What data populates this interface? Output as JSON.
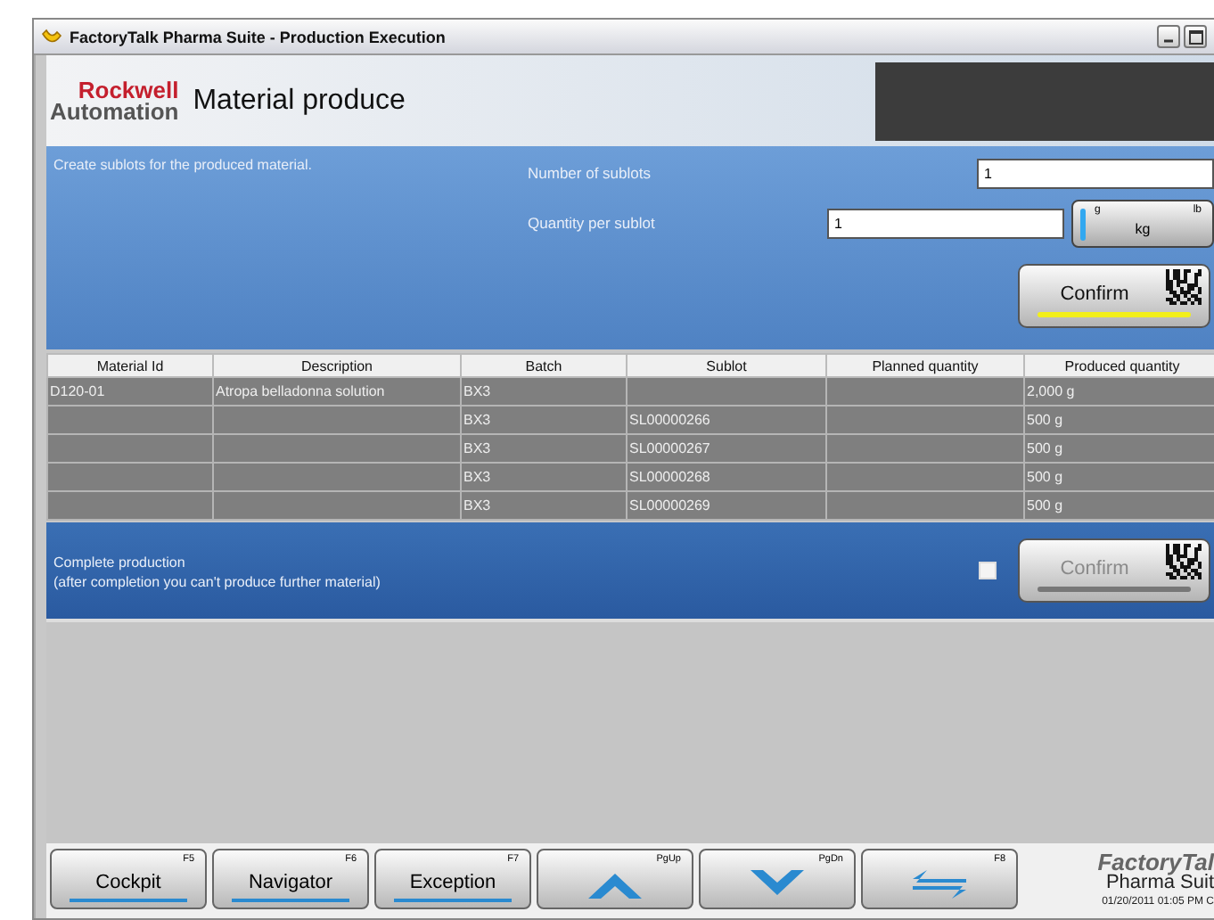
{
  "window": {
    "title": "FactoryTalk Pharma Suite - Production Execution"
  },
  "header": {
    "logo_top": "Rockwell",
    "logo_bottom": "Automation",
    "title": "Material produce"
  },
  "sublot_panel": {
    "instruction": "Create sublots for the produced material.",
    "fields": [
      {
        "label": "Number of sublots",
        "value": "1"
      },
      {
        "label": "Quantity per sublot",
        "value": "1"
      }
    ],
    "unit_switch": {
      "left": "g",
      "center": "kg",
      "right": "lb",
      "level": 0
    },
    "confirm": {
      "label": "Confirm",
      "disabled": false
    }
  },
  "table": {
    "columns": [
      "Material Id",
      "Description",
      "Batch",
      "Sublot",
      "Planned quantity",
      "Produced quantity"
    ],
    "rows": [
      [
        "D120-01",
        "Atropa belladonna solution",
        "BX3",
        "",
        "",
        "2,000 g"
      ],
      [
        "",
        "",
        "BX3",
        "SL00000266",
        "",
        "500 g"
      ],
      [
        "",
        "",
        "BX3",
        "SL00000267",
        "",
        "500 g"
      ],
      [
        "",
        "",
        "BX3",
        "SL00000268",
        "",
        "500 g"
      ],
      [
        "",
        "",
        "BX3",
        "SL00000269",
        "",
        "500 g"
      ]
    ]
  },
  "complete_panel": {
    "lines": [
      "Complete production",
      "(after completion you can't produce further material)"
    ],
    "checked": false,
    "confirm": {
      "label": "Confirm",
      "disabled": true
    }
  },
  "footer": {
    "buttons": [
      {
        "kind": "text",
        "label": "Cockpit",
        "key": "F5"
      },
      {
        "kind": "text",
        "label": "Navigator",
        "key": "F6"
      },
      {
        "kind": "text",
        "label": "Exception",
        "key": "F7"
      },
      {
        "kind": "up",
        "key": "PgUp"
      },
      {
        "kind": "down",
        "key": "PgDn"
      },
      {
        "kind": "swap",
        "key": "F8"
      }
    ],
    "brand_top": "FactoryTal",
    "brand_bottom": "Pharma Suit",
    "timestamp": "01/20/2011 01:05 PM C"
  }
}
